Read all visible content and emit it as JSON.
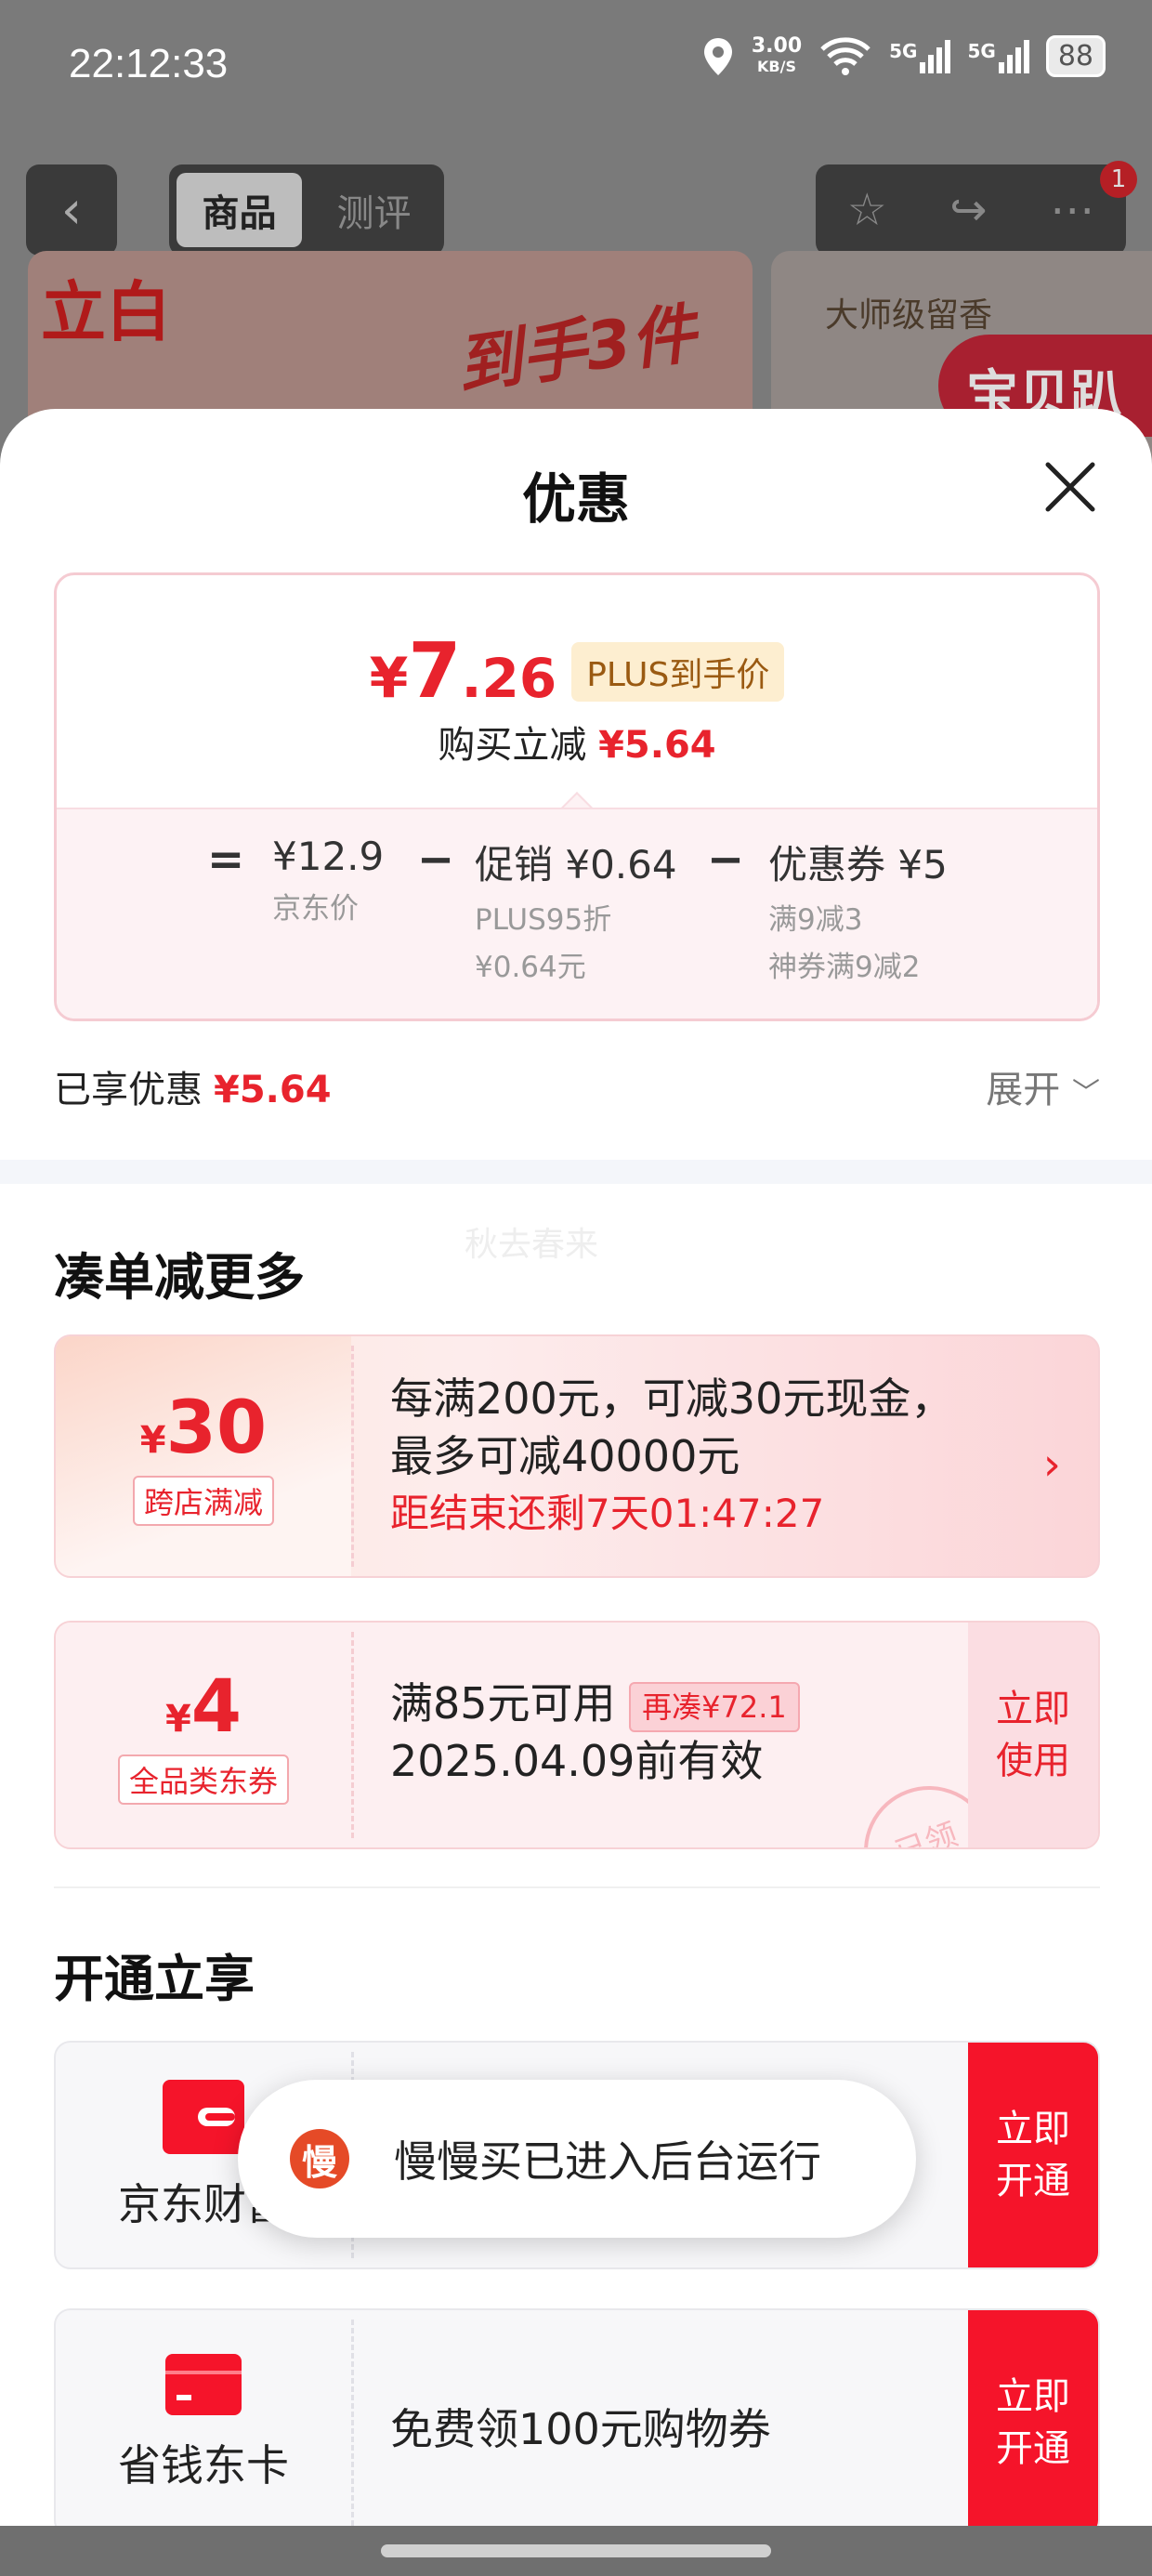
{
  "status_bar": {
    "time": "22:12:33",
    "net_speed_value": "3.00",
    "net_speed_unit": "KB/S",
    "signal1": "5G",
    "signal2": "5G",
    "battery": "88"
  },
  "top_nav": {
    "back_icon": "chevron-left-icon",
    "tabs": [
      {
        "label": "商品",
        "active": true
      },
      {
        "label": "测评",
        "active": false
      }
    ],
    "notification_count": "1"
  },
  "background_banner": {
    "brand": "立白",
    "promo": "到手3件",
    "right_text": "大师级留香",
    "right_badge": "宝贝趴"
  },
  "sheet": {
    "title": "优惠",
    "price_card": {
      "yen": "¥",
      "price_int": "7",
      "price_dec": ".26",
      "plus_tag": "PLUS到手价",
      "save_label": "购买立减",
      "save_amount": "¥5.64",
      "equals": "=",
      "minus": "−",
      "jd_price": "¥12.9",
      "jd_price_label": "京东价",
      "promo_title": "促销 ¥0.64",
      "promo_line1": "PLUS95折",
      "promo_line2": "¥0.64元",
      "coupon_title": "优惠券 ¥5",
      "coupon_line1": "满9减3",
      "coupon_line2": "神券满9减2"
    },
    "enjoyed_label": "已享优惠",
    "enjoyed_amount": "¥5.64",
    "expand_label": "展开",
    "watermark": "秋去春来",
    "section1_title": "凑单减更多",
    "coupon1": {
      "yen": "¥",
      "amount": "30",
      "tag": "跨店满减",
      "line1": "每满200元，可减30元现金，",
      "line2": "最多可减40000元",
      "countdown": "距结束还剩7天01:47:27"
    },
    "coupon2": {
      "yen": "¥",
      "amount": "4",
      "tag": "全品类东券",
      "line1": "满85元可用",
      "extra_tag": "再凑¥72.1",
      "line2": "2025.04.09前有效",
      "use_label": "立即使用",
      "stamp": "已领"
    },
    "section2_title": "开通立享",
    "card1": {
      "name": "京东财富",
      "open_label": "立即开通"
    },
    "card2": {
      "name": "省钱东卡",
      "desc": "免费领100元购物券",
      "open_label": "立即开通"
    }
  },
  "toast": {
    "icon_char": "慢",
    "message": "慢慢买已进入后台运行"
  }
}
